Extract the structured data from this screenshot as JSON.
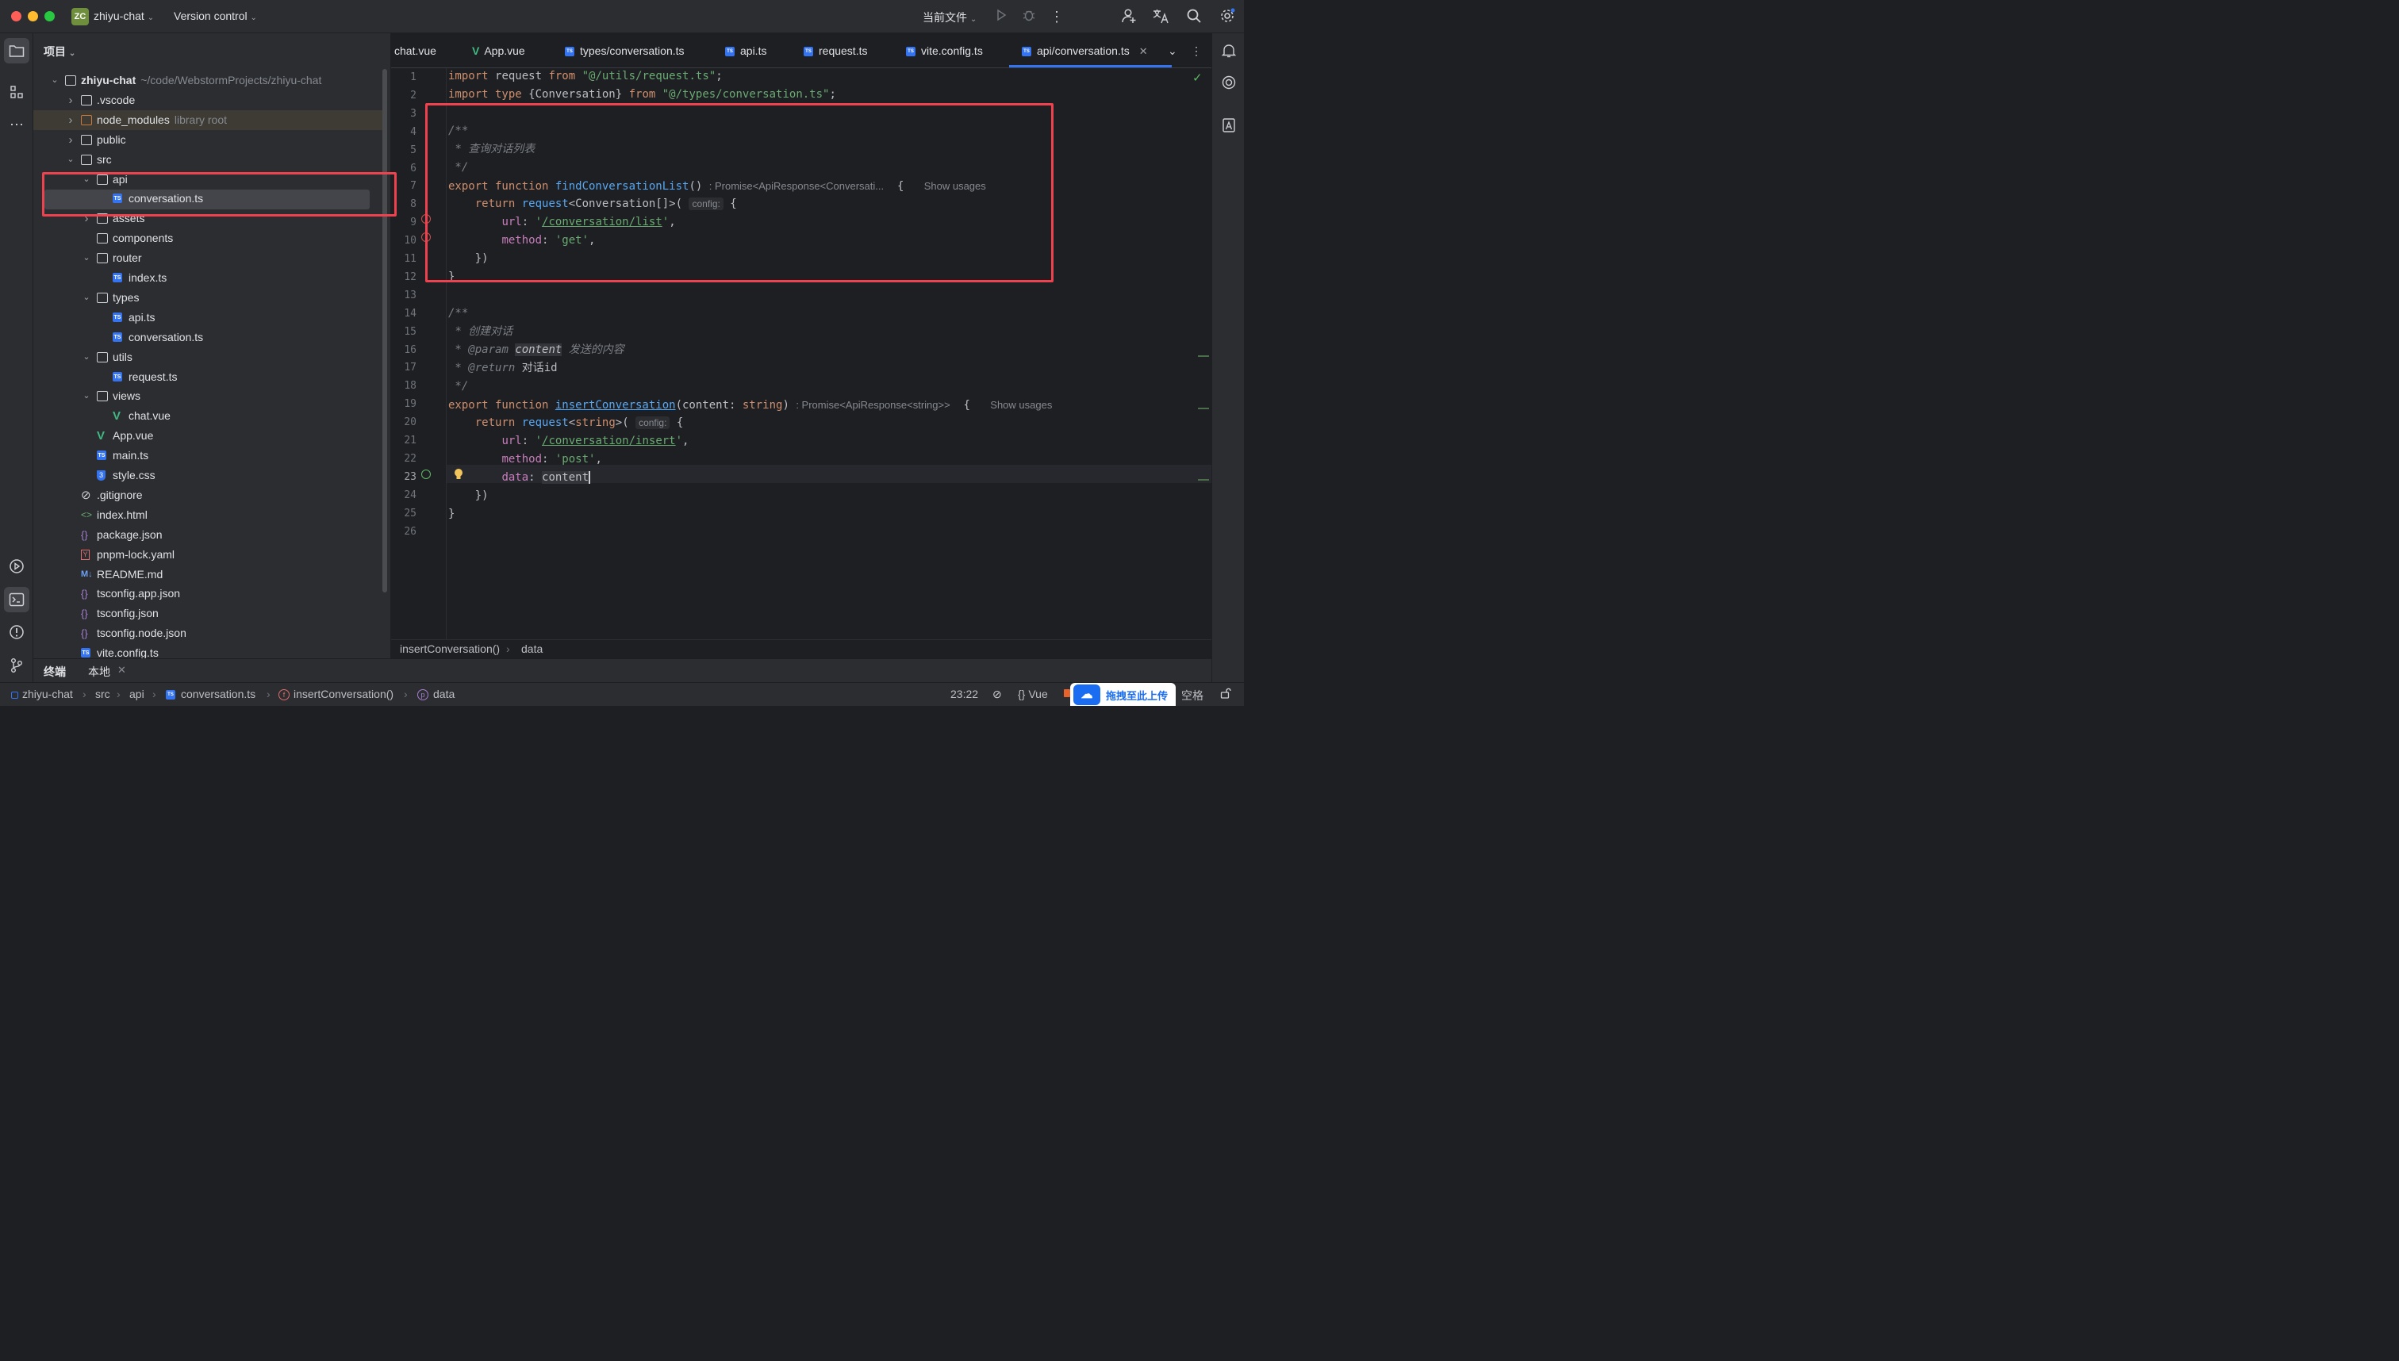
{
  "titlebar": {
    "project_badge": "ZC",
    "project_name": "zhiyu-chat",
    "vcs": "Version control",
    "run_config": "当前文件"
  },
  "project_panel": {
    "title": "项目",
    "tree": [
      {
        "label": "zhiyu-chat",
        "extra": "~/code/WebstormProjects/zhiyu-chat",
        "icon": "folder-icon",
        "level": 0,
        "expanded": true,
        "bold": true
      },
      {
        "label": ".vscode",
        "icon": "folder-icon",
        "level": 1,
        "expanded": false
      },
      {
        "label": "node_modules",
        "extra": "library root",
        "icon": "folder-icon",
        "level": 1,
        "expanded": false,
        "highlighted": true
      },
      {
        "label": "public",
        "icon": "folder-icon",
        "level": 1,
        "expanded": false
      },
      {
        "label": "src",
        "icon": "folder-icon",
        "level": 1,
        "expanded": true
      },
      {
        "label": "api",
        "icon": "folder-icon",
        "level": 2,
        "expanded": true
      },
      {
        "label": "conversation.ts",
        "icon": "ts-file-icon",
        "level": 3,
        "selected": true
      },
      {
        "label": "assets",
        "icon": "folder-icon",
        "level": 2,
        "expanded": false
      },
      {
        "label": "components",
        "icon": "folder-icon",
        "level": 2
      },
      {
        "label": "router",
        "icon": "folder-icon",
        "level": 2,
        "expanded": true
      },
      {
        "label": "index.ts",
        "icon": "ts-file-icon",
        "level": 3
      },
      {
        "label": "types",
        "icon": "folder-icon",
        "level": 2,
        "expanded": true
      },
      {
        "label": "api.ts",
        "icon": "ts-file-icon",
        "level": 3
      },
      {
        "label": "conversation.ts",
        "icon": "ts-file-icon",
        "level": 3
      },
      {
        "label": "utils",
        "icon": "folder-icon",
        "level": 2,
        "expanded": true
      },
      {
        "label": "request.ts",
        "icon": "ts-file-icon",
        "level": 3
      },
      {
        "label": "views",
        "icon": "folder-icon",
        "level": 2,
        "expanded": true
      },
      {
        "label": "chat.vue",
        "icon": "vue-file-icon",
        "level": 3
      },
      {
        "label": "App.vue",
        "icon": "vue-file-icon",
        "level": 2
      },
      {
        "label": "main.ts",
        "icon": "ts-file-icon",
        "level": 2
      },
      {
        "label": "style.css",
        "icon": "css-file-icon",
        "level": 2
      },
      {
        "label": ".gitignore",
        "icon": "gitignore-icon",
        "level": 1
      },
      {
        "label": "index.html",
        "icon": "html-file-icon",
        "level": 1
      },
      {
        "label": "package.json",
        "icon": "json-file-icon",
        "level": 1
      },
      {
        "label": "pnpm-lock.yaml",
        "icon": "yaml-file-icon",
        "level": 1
      },
      {
        "label": "README.md",
        "icon": "markdown-file-icon",
        "level": 1
      },
      {
        "label": "tsconfig.app.json",
        "icon": "json-file-icon",
        "level": 1
      },
      {
        "label": "tsconfig.json",
        "icon": "json-file-icon",
        "level": 1
      },
      {
        "label": "tsconfig.node.json",
        "icon": "json-file-icon",
        "level": 1
      },
      {
        "label": "vite.config.ts",
        "icon": "ts-file-icon",
        "level": 1
      }
    ]
  },
  "tabs": [
    {
      "label": "chat.vue",
      "icon": "vue-file-icon"
    },
    {
      "label": "App.vue",
      "icon": "vue-file-icon"
    },
    {
      "label": "types/conversation.ts",
      "icon": "ts-file-icon"
    },
    {
      "label": "api.ts",
      "icon": "ts-file-icon"
    },
    {
      "label": "request.ts",
      "icon": "ts-file-icon"
    },
    {
      "label": "vite.config.ts",
      "icon": "ts-file-icon"
    },
    {
      "label": "api/conversation.ts",
      "icon": "ts-file-icon",
      "active": true
    }
  ],
  "editor": {
    "current_line": 23,
    "line_count": 26,
    "hints": {
      "find_return": ": Promise<ApiResponse<Conversati...",
      "insert_return": ": Promise<ApiResponse<string>>",
      "show_usages": "Show usages",
      "config": "config:"
    },
    "comments": {
      "query_list": "* 查询对话列表",
      "create": "* 创建对话",
      "param_desc": "发送的内容",
      "return_desc": "对话id"
    }
  },
  "editor_breadcrumb": {
    "items": [
      "insertConversation()",
      "data"
    ]
  },
  "bottom_tabs": {
    "terminal": "终端",
    "local": "本地"
  },
  "statusbar": {
    "crumbs": [
      "zhiyu-chat",
      "src",
      "api",
      "conversation.ts",
      "insertConversation()",
      "data"
    ],
    "position": "23:22",
    "language": "Vue",
    "indent": "空格"
  },
  "upload_widget": {
    "label": "拖拽至此上传"
  },
  "colors": {
    "accent": "#3574f0",
    "annotation_red": "#f0414f",
    "keyword": "#cf8e6d",
    "string": "#6aab73",
    "function": "#56a8f5"
  }
}
